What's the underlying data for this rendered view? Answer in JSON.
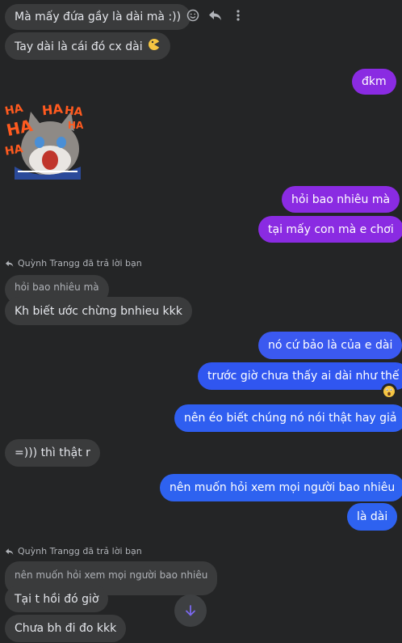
{
  "messages": {
    "m1": "Mà mấy đứa gầy là dài mà :))",
    "m2": "Tay dài là cái đó cx dài",
    "m3": "đkm",
    "m4": "hỏi bao nhiêu mà",
    "m5": "tại mấy con mà e chơi",
    "reply1_header": "Quỳnh Trangg đã trả lời bạn",
    "reply1_quote": "hỏi bao nhiêu mà",
    "m6": "Kh biết ước chừng bnhieu kkk",
    "m7": "nó cứ bảo là của e dài",
    "m8": "trước giờ chưa thấy ai dài như thế",
    "m9": "nên éo biết chúng nó nói thật hay giả",
    "m10": "=))) thì thật r",
    "m11": "nên muốn hỏi xem mọi người bao nhiêu",
    "m12": "là dài",
    "reply2_header": "Quỳnh Trangg đã trả lời bạn",
    "reply2_quote": "nên muốn hỏi xem mọi người bao nhiêu",
    "m13": "Tại t hồi đó giờ",
    "m14": "Chưa bh đi đo kkk"
  },
  "sticker": {
    "text": [
      "HA",
      "HA",
      "HA",
      "HA",
      "HA",
      "HA"
    ]
  },
  "colors": {
    "background": "#242526",
    "incoming": "#3a3b3c",
    "outgoing_purple": "#8a2be2",
    "outgoing_blue": "#2f5ef0"
  },
  "icons": [
    "emoji-icon",
    "reply-icon",
    "more-icon",
    "emoji-face-icon",
    "shocked-reaction-icon",
    "arrow-down-icon",
    "reply-arrow-icon"
  ]
}
